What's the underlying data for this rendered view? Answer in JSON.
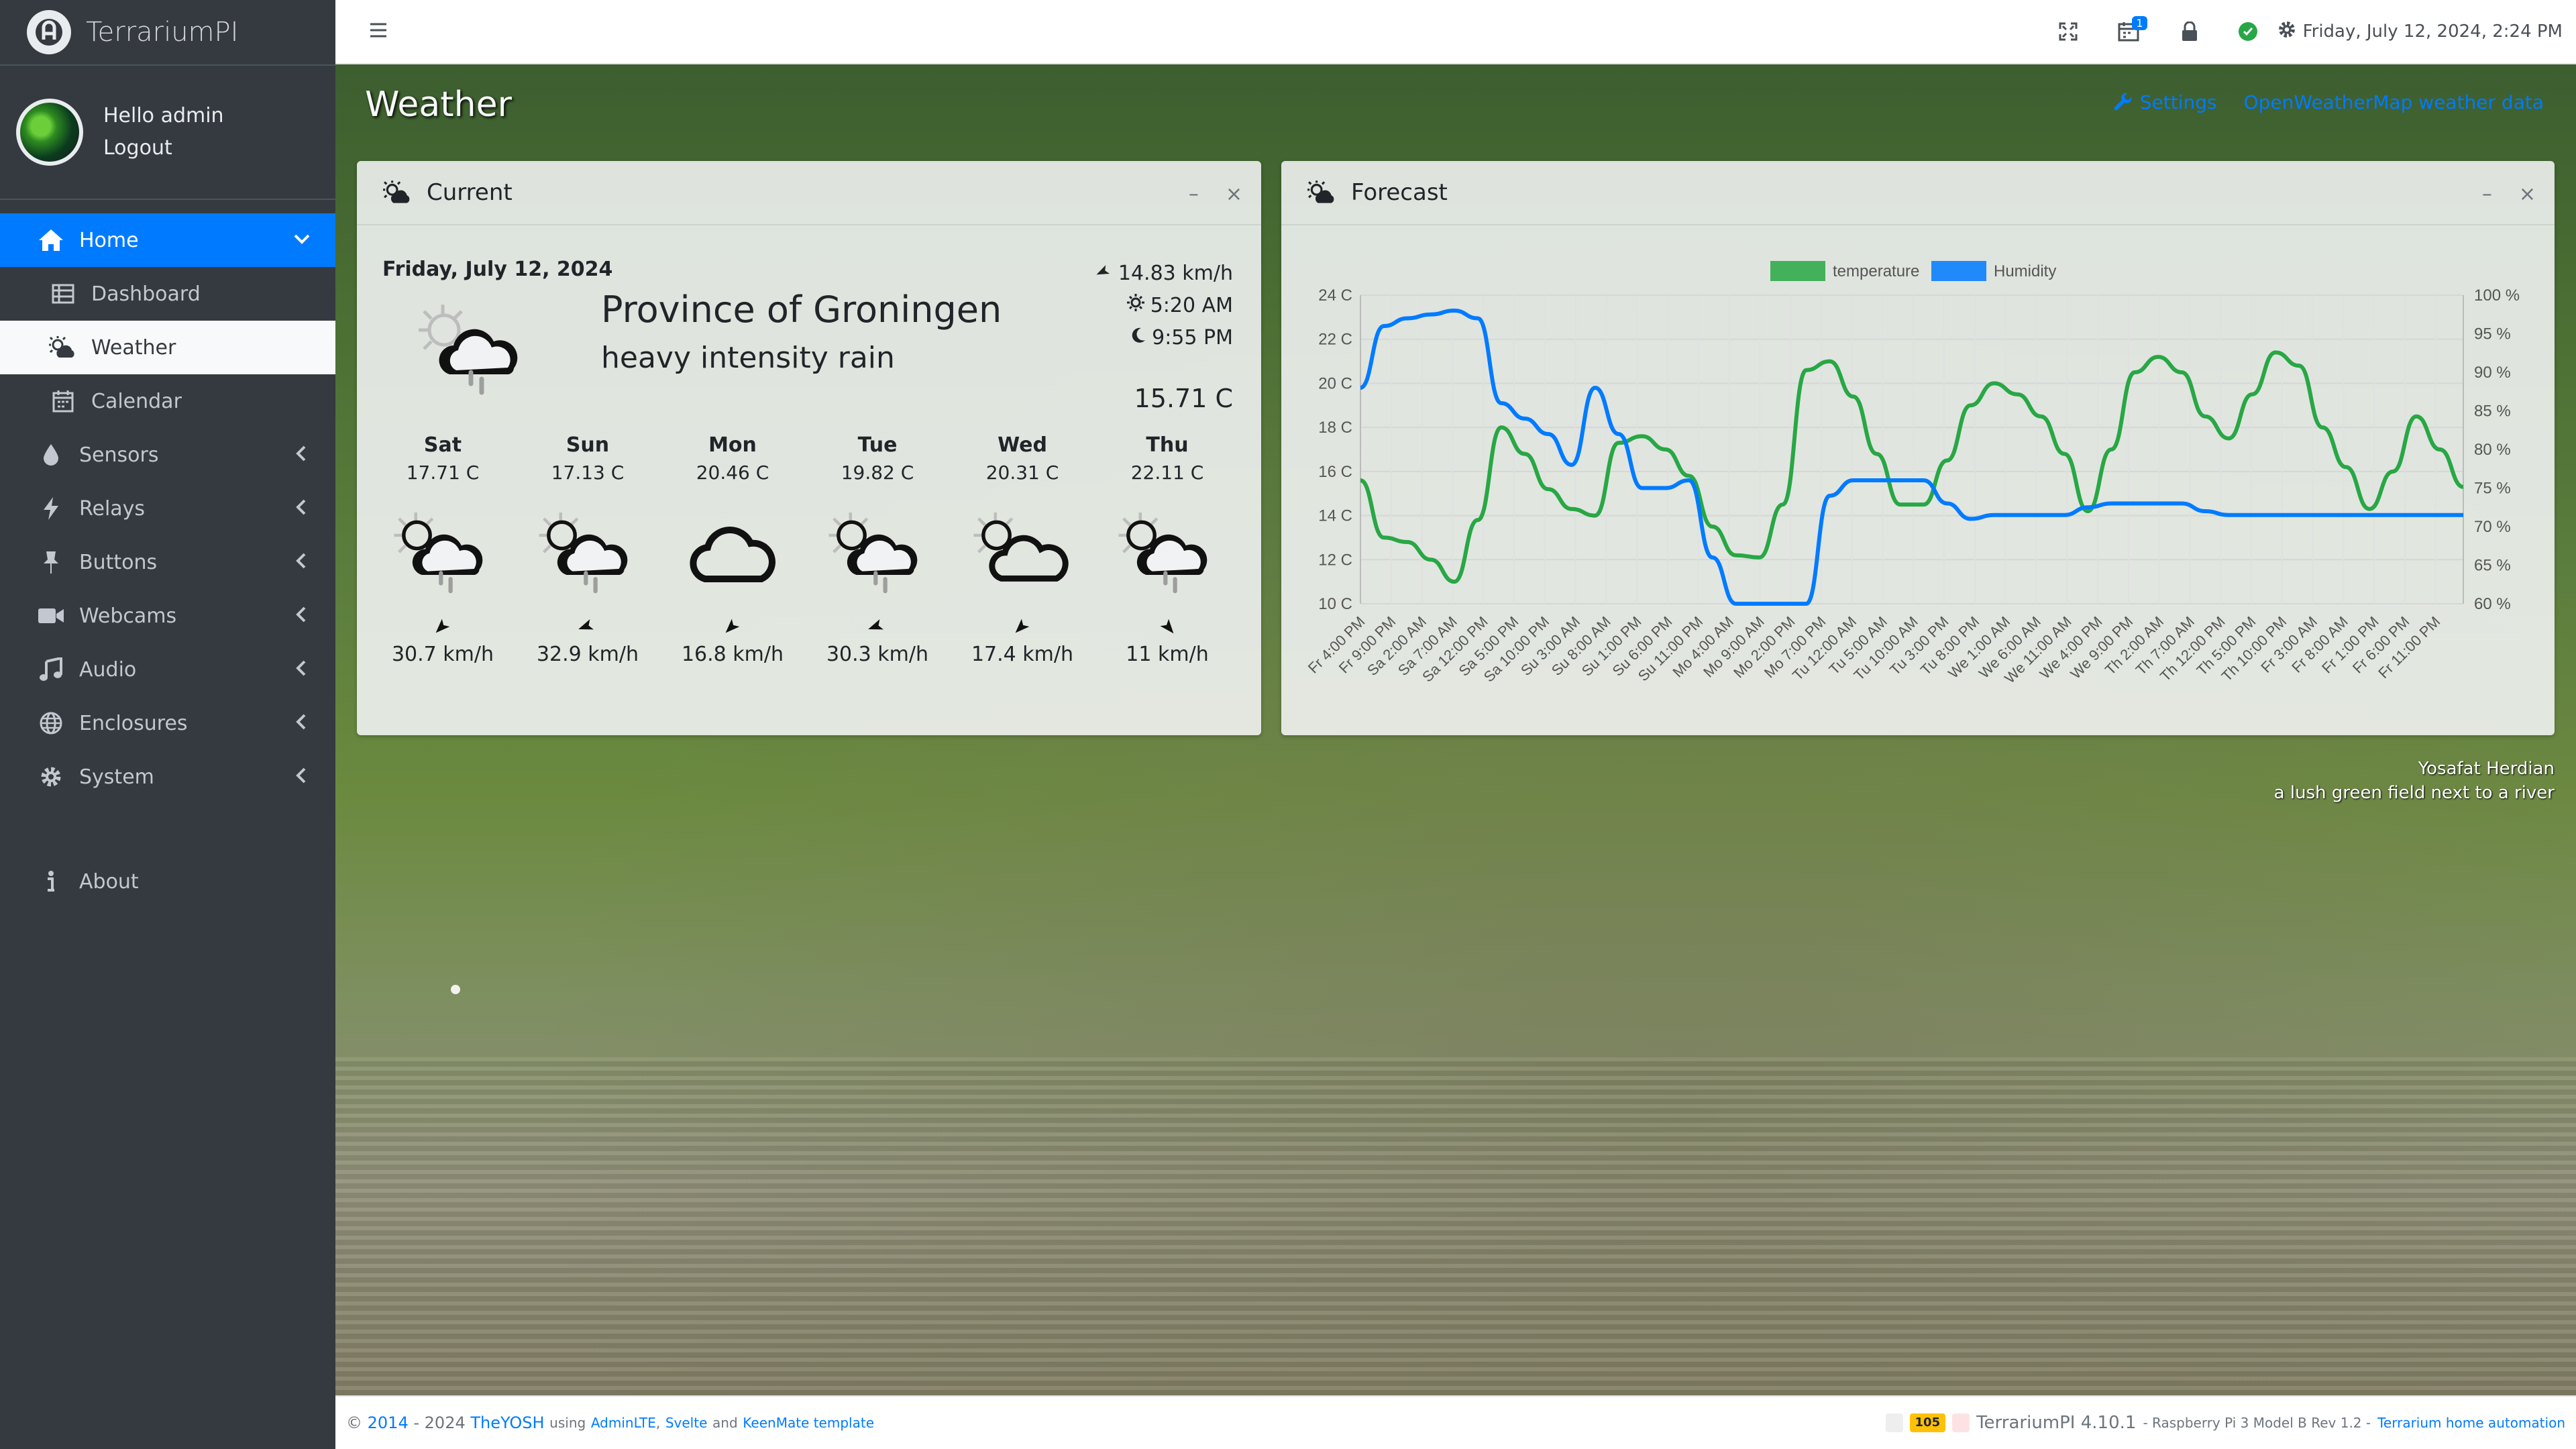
{
  "app": {
    "brand": "TerrariumPI"
  },
  "user": {
    "greeting": "Hello admin",
    "logout": "Logout"
  },
  "sidebar": {
    "home": "Home",
    "dashboard": "Dashboard",
    "weather": "Weather",
    "calendar": "Calendar",
    "sensors": "Sensors",
    "relays": "Relays",
    "buttons": "Buttons",
    "webcams": "Webcams",
    "audio": "Audio",
    "enclosures": "Enclosures",
    "system": "System",
    "about": "About"
  },
  "topbar": {
    "datetime": "Friday, July 12, 2024, 2:24 PM",
    "calendar_badge": "1"
  },
  "page": {
    "title": "Weather",
    "settings_link": "Settings",
    "owm_link": "OpenWeatherMap weather data"
  },
  "current": {
    "card_title": "Current",
    "date": "Friday, July 12, 2024",
    "location": "Province of Groningen",
    "description": "heavy intensity rain",
    "wind": "14.83 km/h",
    "sunrise": "5:20 AM",
    "sunset": "9:55 PM",
    "temperature": "15.71 C"
  },
  "days": [
    {
      "name": "Sat",
      "temp": "17.71 C",
      "icon": "sun-cloud-rain-icon",
      "wind": "30.7 km/h",
      "wind_dir": 225
    },
    {
      "name": "Sun",
      "temp": "17.13 C",
      "icon": "sun-cloud-rain-icon",
      "wind": "32.9 km/h",
      "wind_dir": 250
    },
    {
      "name": "Mon",
      "temp": "20.46 C",
      "icon": "cloud-icon",
      "wind": "16.8 km/h",
      "wind_dir": 225
    },
    {
      "name": "Tue",
      "temp": "19.82 C",
      "icon": "sun-cloud-rain-icon",
      "wind": "30.3 km/h",
      "wind_dir": 250
    },
    {
      "name": "Wed",
      "temp": "20.31 C",
      "icon": "sun-cloud-icon",
      "wind": "17.4 km/h",
      "wind_dir": 225
    },
    {
      "name": "Thu",
      "temp": "22.11 C",
      "icon": "sun-cloud-rain-icon",
      "wind": "11 km/h",
      "wind_dir": 140
    }
  ],
  "forecast": {
    "card_title": "Forecast"
  },
  "chart_data": {
    "type": "line",
    "legend": [
      "temperature",
      "Humidity"
    ],
    "legend_position": "top",
    "grid": true,
    "y_left": {
      "ticks": [
        "10 C",
        "12 C",
        "14 C",
        "16 C",
        "18 C",
        "20 C",
        "22 C",
        "24 C"
      ],
      "range": [
        10,
        24
      ]
    },
    "y_right": {
      "ticks": [
        "60 %",
        "65 %",
        "70 %",
        "75 %",
        "80 %",
        "85 %",
        "90 %",
        "95 %",
        "100 %"
      ],
      "range": [
        60,
        100
      ]
    },
    "x_labels": [
      "Fr 4:00 PM",
      "Fr 9:00 PM",
      "Sa 2:00 AM",
      "Sa 7:00 AM",
      "Sa 12:00 PM",
      "Sa 5:00 PM",
      "Sa 10:00 PM",
      "Su 3:00 AM",
      "Su 8:00 AM",
      "Su 1:00 PM",
      "Su 6:00 PM",
      "Su 11:00 PM",
      "Mo 4:00 AM",
      "Mo 9:00 AM",
      "Mo 2:00 PM",
      "Mo 7:00 PM",
      "Tu 12:00 AM",
      "Tu 5:00 AM",
      "Tu 10:00 AM",
      "Tu 3:00 PM",
      "Tu 8:00 PM",
      "We 1:00 AM",
      "We 6:00 AM",
      "We 11:00 AM",
      "We 4:00 PM",
      "We 9:00 PM",
      "Th 2:00 AM",
      "Th 7:00 AM",
      "Th 12:00 PM",
      "Th 5:00 PM",
      "Th 10:00 PM",
      "Fr 3:00 AM",
      "Fr 8:00 AM",
      "Fr 1:00 PM",
      "Fr 6:00 PM",
      "Fr 11:00 PM"
    ],
    "series": [
      {
        "name": "temperature",
        "color": "#28a745",
        "axis": "left",
        "values": [
          15.6,
          13.0,
          12.8,
          12.0,
          11.0,
          13.8,
          18.0,
          16.8,
          15.2,
          14.3,
          14.0,
          17.3,
          17.6,
          17.0,
          15.8,
          13.5,
          12.2,
          12.1,
          14.5,
          20.6,
          21.0,
          19.4,
          16.8,
          14.5,
          14.5,
          16.5,
          19.0,
          20.0,
          19.5,
          18.5,
          16.8,
          14.2,
          17.0,
          20.5,
          21.2,
          20.5,
          18.5,
          17.5,
          19.5,
          21.4,
          20.8,
          18.0,
          16.2,
          14.3,
          16.0,
          18.5,
          17.0,
          15.3
        ]
      },
      {
        "name": "Humidity",
        "color": "#007bff",
        "axis": "right",
        "values": [
          88,
          96,
          97,
          97.5,
          98,
          97,
          86,
          84,
          82,
          78,
          88,
          82,
          75,
          75,
          76,
          66,
          60,
          60,
          60,
          60,
          74,
          76,
          76,
          76,
          76,
          73,
          71,
          71.5,
          71.5,
          71.5,
          71.5,
          72.5,
          73,
          73,
          73,
          73,
          72,
          71.5,
          71.5,
          71.5,
          71.5,
          71.5,
          71.5,
          71.5,
          71.5,
          71.5,
          71.5,
          71.5
        ]
      }
    ]
  },
  "credit": {
    "author": "Yosafat Herdian",
    "caption": "a lush green field next to a river"
  },
  "footer": {
    "copyright": "©",
    "year_start": "2014",
    "year_end": "- 2024",
    "author": "TheYOSH",
    "using": "using",
    "adminlte": "AdminLTE",
    "comma": ",",
    "svelte": "Svelte",
    "and": "and",
    "keenmate": "KeenMate template",
    "badge": "105",
    "version": "TerrariumPI 4.10.1",
    "device": "- Raspberry Pi 3 Model B Rev 1.2 -",
    "dash": "-",
    "homepage": "Terrarium home automation"
  }
}
